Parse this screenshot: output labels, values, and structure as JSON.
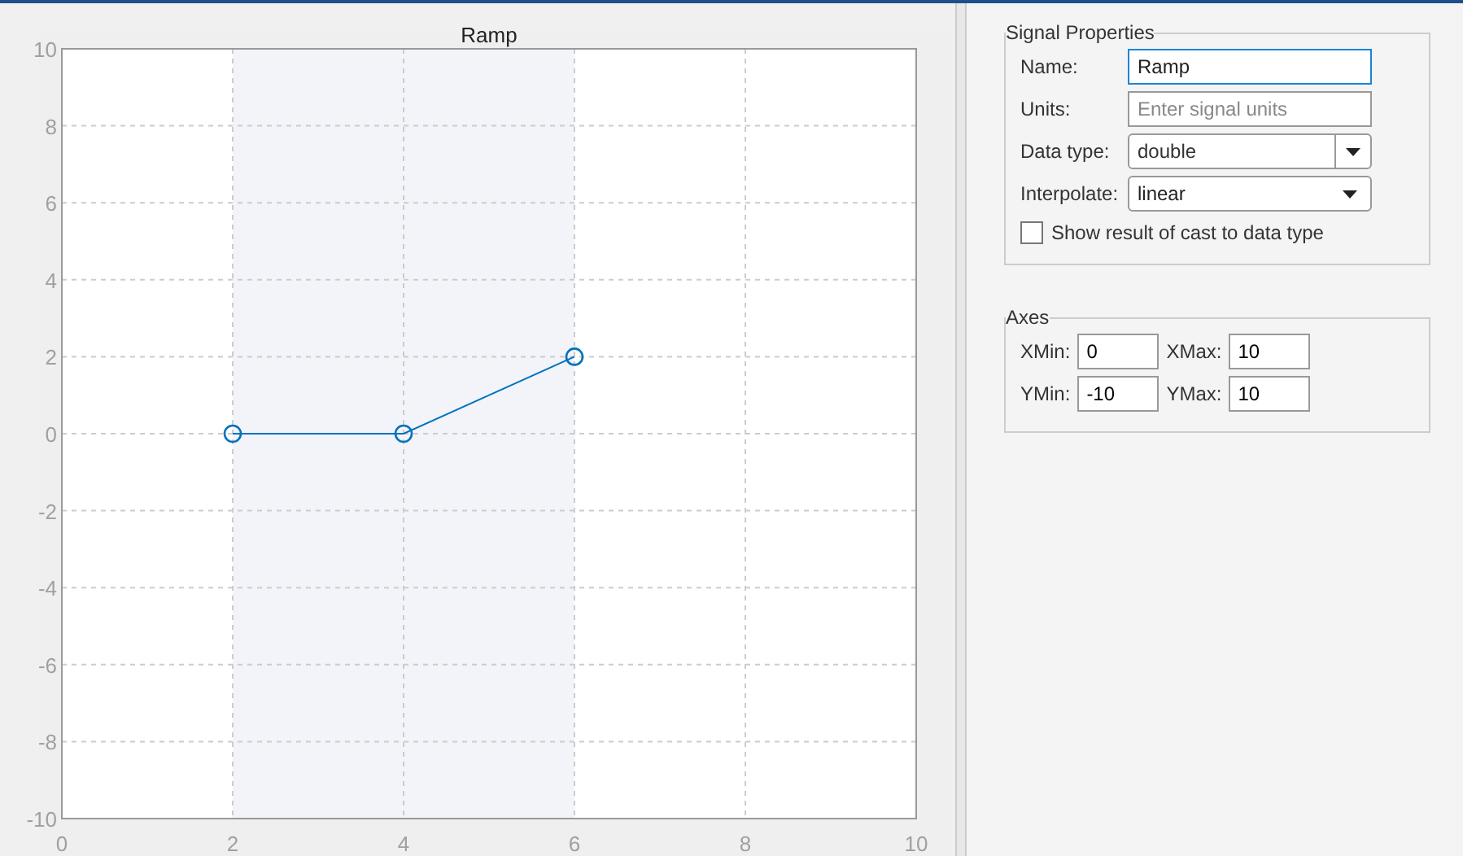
{
  "plot": {
    "chart_data": {
      "type": "line",
      "title": "Ramp",
      "x": [
        2,
        4,
        6
      ],
      "series": [
        {
          "color": "#0072bd",
          "marker": "o",
          "values": [
            0,
            0,
            2
          ]
        }
      ],
      "grid": true,
      "xlim": [
        0,
        10
      ],
      "ylim": [
        -10,
        10
      ],
      "xticks": [
        0,
        2,
        4,
        6,
        8,
        10
      ],
      "yticks": [
        -10,
        -8,
        -6,
        -4,
        -2,
        0,
        2,
        4,
        6,
        8,
        10
      ],
      "bands": [
        {
          "axis": "x",
          "from": 2,
          "to": 6
        }
      ]
    }
  },
  "signal_properties": {
    "title": "Signal Properties",
    "fields": [
      {
        "kind": "text",
        "label": "Name:",
        "value": "Ramp",
        "focused": true
      },
      {
        "kind": "text",
        "label": "Units:",
        "placeholder": "Enter signal units",
        "focused": false
      },
      {
        "kind": "combo",
        "label": "Data type:",
        "value": "double"
      },
      {
        "kind": "dropdown",
        "label": "Interpolate:",
        "value": "linear"
      }
    ],
    "checkbox": {
      "label": "Show result of cast to data type",
      "checked": false
    }
  },
  "axes": {
    "title": "Axes",
    "fields": [
      {
        "label": "XMin:",
        "value": "0"
      },
      {
        "label": "XMax:",
        "value": "10"
      },
      {
        "label": "YMin:",
        "value": "-10"
      },
      {
        "label": "YMax:",
        "value": "10"
      }
    ]
  }
}
